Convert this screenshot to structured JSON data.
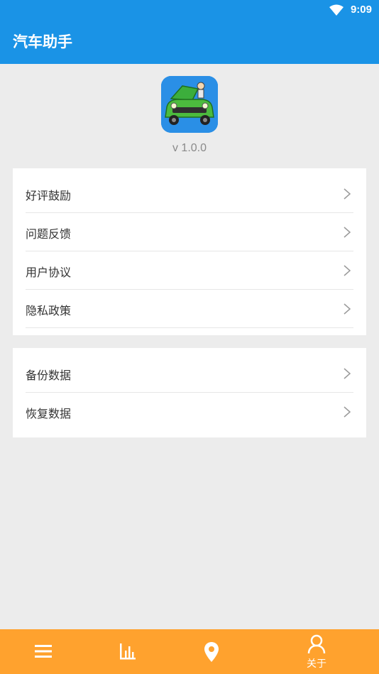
{
  "status_bar": {
    "time": "9:09",
    "wifi_icon": "wifi-icon"
  },
  "app_bar": {
    "title": "汽车助手"
  },
  "about": {
    "app_icon": "car-repair-app-icon",
    "version": "v 1.0.0"
  },
  "menu_group_1": [
    {
      "label": "好评鼓励"
    },
    {
      "label": "问题反馈"
    },
    {
      "label": "用户协议"
    },
    {
      "label": "隐私政策"
    }
  ],
  "menu_group_2": [
    {
      "label": "备份数据"
    },
    {
      "label": "恢复数据"
    }
  ],
  "bottom_nav": {
    "tabs": [
      {
        "icon": "list-icon",
        "label": ""
      },
      {
        "icon": "bar-chart-icon",
        "label": ""
      },
      {
        "icon": "location-pin-icon",
        "label": ""
      },
      {
        "icon": "person-icon",
        "label": "关于",
        "selected": true
      }
    ]
  },
  "colors": {
    "primary": "#1a93e6",
    "nav": "#ffa22e",
    "background": "#ececec"
  }
}
